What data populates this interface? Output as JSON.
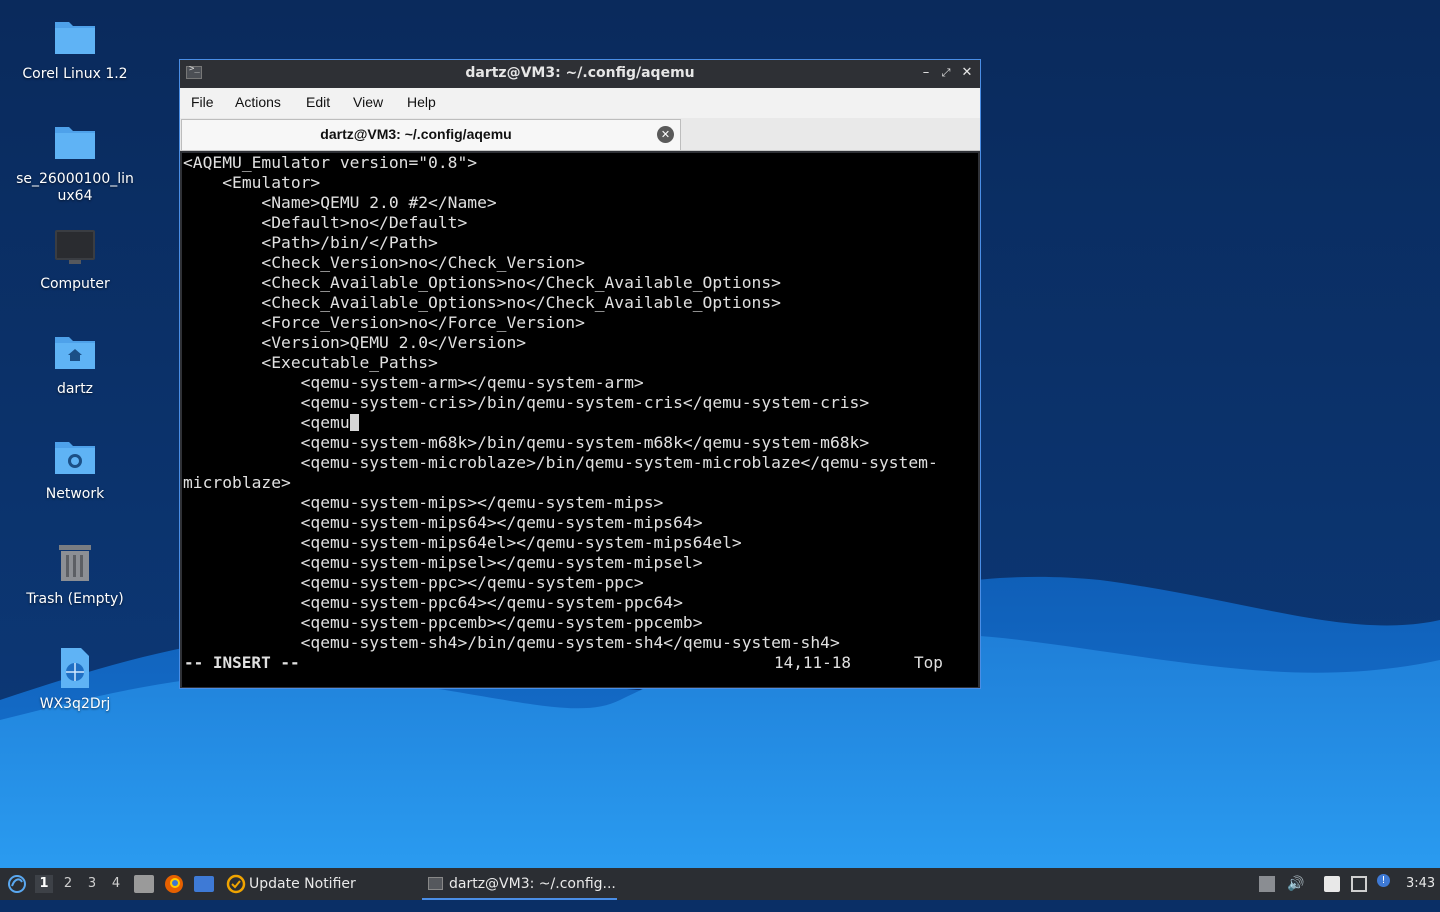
{
  "desktop": {
    "icons": [
      {
        "label": "Corel Linux 1.2",
        "icon": "folder-icon"
      },
      {
        "label": "se_26000100_lin\nux64",
        "icon": "folder-icon"
      },
      {
        "label": "Computer",
        "icon": "computer-icon"
      },
      {
        "label": "dartz",
        "icon": "home-folder-icon"
      },
      {
        "label": "Network",
        "icon": "network-folder-icon"
      },
      {
        "label": "Trash (Empty)",
        "icon": "trash-icon"
      },
      {
        "label": "WX3q2Drj",
        "icon": "web-file-icon"
      }
    ]
  },
  "window": {
    "title": "dartz@VM3: ~/.config/aqemu",
    "menu": [
      "File",
      "Actions",
      "Edit",
      "View",
      "Help"
    ],
    "tab_label": "dartz@VM3: ~/.config/aqemu",
    "terminal": {
      "lines": [
        "<AQEMU_Emulator version=\"0.8\">",
        "    <Emulator>",
        "        <Name>QEMU 2.0 #2</Name>",
        "        <Default>no</Default>",
        "        <Path>/bin/</Path>",
        "        <Check_Version>no</Check_Version>",
        "        <Check_Available_Options>no</Check_Available_Options>",
        "        <Check_Available_Options>no</Check_Available_Options>",
        "        <Force_Version>no</Force_Version>",
        "        <Version>QEMU 2.0</Version>",
        "        <Executable_Paths>",
        "            <qemu-system-arm></qemu-system-arm>",
        "            <qemu-system-cris>/bin/qemu-system-cris</qemu-system-cris>",
        "            <qemu",
        "            <qemu-system-m68k>/bin/qemu-system-m68k</qemu-system-m68k>",
        "            <qemu-system-microblaze>/bin/qemu-system-microblaze</qemu-system-",
        "microblaze>",
        "            <qemu-system-mips></qemu-system-mips>",
        "            <qemu-system-mips64></qemu-system-mips64>",
        "            <qemu-system-mips64el></qemu-system-mips64el>",
        "            <qemu-system-mipsel></qemu-system-mipsel>",
        "            <qemu-system-ppc></qemu-system-ppc>",
        "            <qemu-system-ppc64></qemu-system-ppc64>",
        "            <qemu-system-ppcemb></qemu-system-ppcemb>",
        "            <qemu-system-sh4>/bin/qemu-system-sh4</qemu-system-sh4>"
      ],
      "cursor_line": 14,
      "status_mode": "-- INSERT --",
      "status_position": "14,11-18",
      "status_scroll": "Top"
    }
  },
  "taskbar": {
    "workspaces": [
      "1",
      "2",
      "3",
      "4"
    ],
    "active_workspace": "1",
    "tasks": [
      {
        "label": "Update Notifier",
        "icon": "update-notifier-icon"
      },
      {
        "label": "dartz@VM3: ~/.config...",
        "icon": "terminal-icon"
      }
    ],
    "clock": "3:43"
  },
  "colors": {
    "accent": "#4a8ee6",
    "terminal_bg": "#000000",
    "taskbar_bg": "#2b2e33",
    "wallpaper_dark": "#0a2f66",
    "wallpaper_light": "#1a8fe6"
  }
}
